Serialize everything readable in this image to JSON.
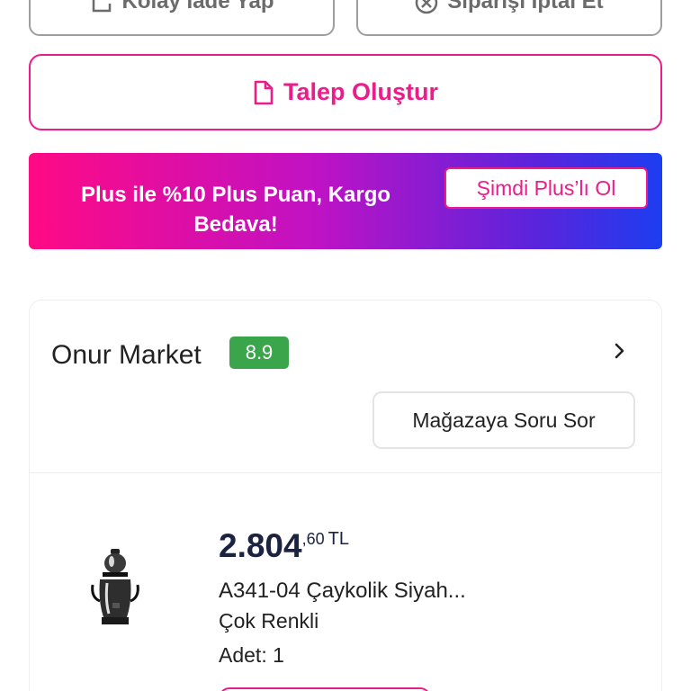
{
  "actions": {
    "return_label": "Kolay İade Yap",
    "cancel_label": "Siparişi İptal Et",
    "request_label": "Talep Oluştur"
  },
  "plus_banner": {
    "text": "Plus ile %10 Plus Puan, Kargo Bedava!",
    "cta_label": "Şimdi Plus’lı Ol"
  },
  "store": {
    "name": "Onur Market",
    "rating": "8.9",
    "ask_button_label": "Mağazaya Soru Sor"
  },
  "product": {
    "price_main": "2.804",
    "price_decimal": ",60",
    "currency": "TL",
    "name": "A341-04 Çaykolik Siyah...",
    "color": "Çok Renkli",
    "quantity": "Adet: 1"
  },
  "colors": {
    "accent": "#ec1c8a",
    "rating_green": "#3aa54a",
    "banner_start": "#ff0a84",
    "banner_end": "#1d3df0"
  },
  "icons": {
    "return": "return-box-icon",
    "cancel": "cancel-circle-icon",
    "request": "document-icon",
    "store_chevron": "chevron-right-icon"
  }
}
